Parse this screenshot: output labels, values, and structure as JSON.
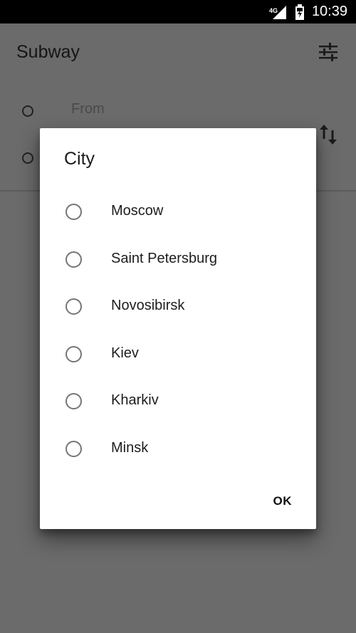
{
  "status_bar": {
    "network": "4G",
    "time": "10:39",
    "icons": [
      "signal-icon",
      "battery-icon"
    ]
  },
  "app": {
    "title": "Subway",
    "from_placeholder": "From",
    "icons": [
      "tune-icon",
      "swap-vertical-icon"
    ]
  },
  "dialog": {
    "title": "City",
    "options": [
      {
        "label": "Moscow",
        "selected": false
      },
      {
        "label": "Saint Petersburg",
        "selected": false
      },
      {
        "label": "Novosibirsk",
        "selected": false
      },
      {
        "label": "Kiev",
        "selected": false
      },
      {
        "label": "Kharkiv",
        "selected": false
      },
      {
        "label": "Minsk",
        "selected": false
      }
    ],
    "ok_label": "OK"
  },
  "colors": {
    "scrim": "#6b6b6b",
    "status_bar": "#000000",
    "dialog": "#ffffff",
    "radio": "#757575"
  }
}
